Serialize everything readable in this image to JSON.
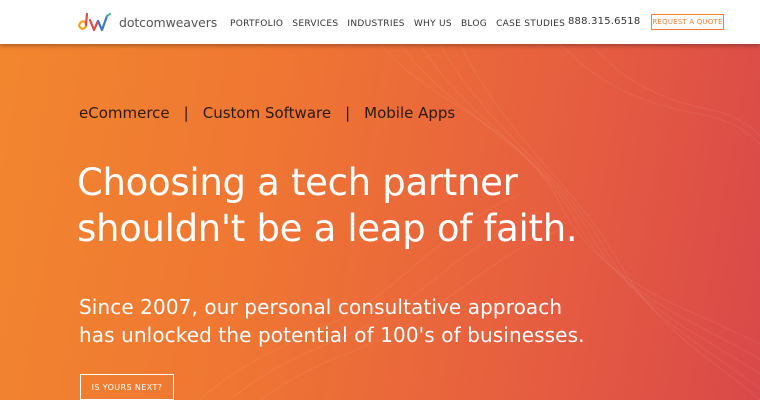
{
  "brand": {
    "name": "dotcomweavers",
    "logo_icon": "dw-weave-logo",
    "logo_colors": [
      "#f4a21d",
      "#e2494a",
      "#3d76c6",
      "#4bb89a"
    ]
  },
  "nav": {
    "items": [
      "PORTFOLIO",
      "SERVICES",
      "INDUSTRIES",
      "WHY US",
      "BLOG",
      "CASE STUDIES"
    ]
  },
  "header": {
    "phone": "888.315.6518",
    "quote_button": "REQUEST A QUOTE"
  },
  "hero": {
    "categories": [
      "eCommerce",
      "Custom Software",
      "Mobile Apps"
    ],
    "separator": "|",
    "headline_line1": "Choosing a tech partner",
    "headline_line2": "shouldn't be a leap of faith.",
    "subtext_line1": "Since 2007, our personal consultative approach",
    "subtext_line2": "has unlocked the potential of 100's of businesses.",
    "cta": "IS YOURS NEXT?"
  },
  "colors": {
    "accent": "#f07f3c",
    "hero_start": "#f2862f",
    "hero_end": "#d9484a",
    "category_text": "#2b1a12"
  }
}
